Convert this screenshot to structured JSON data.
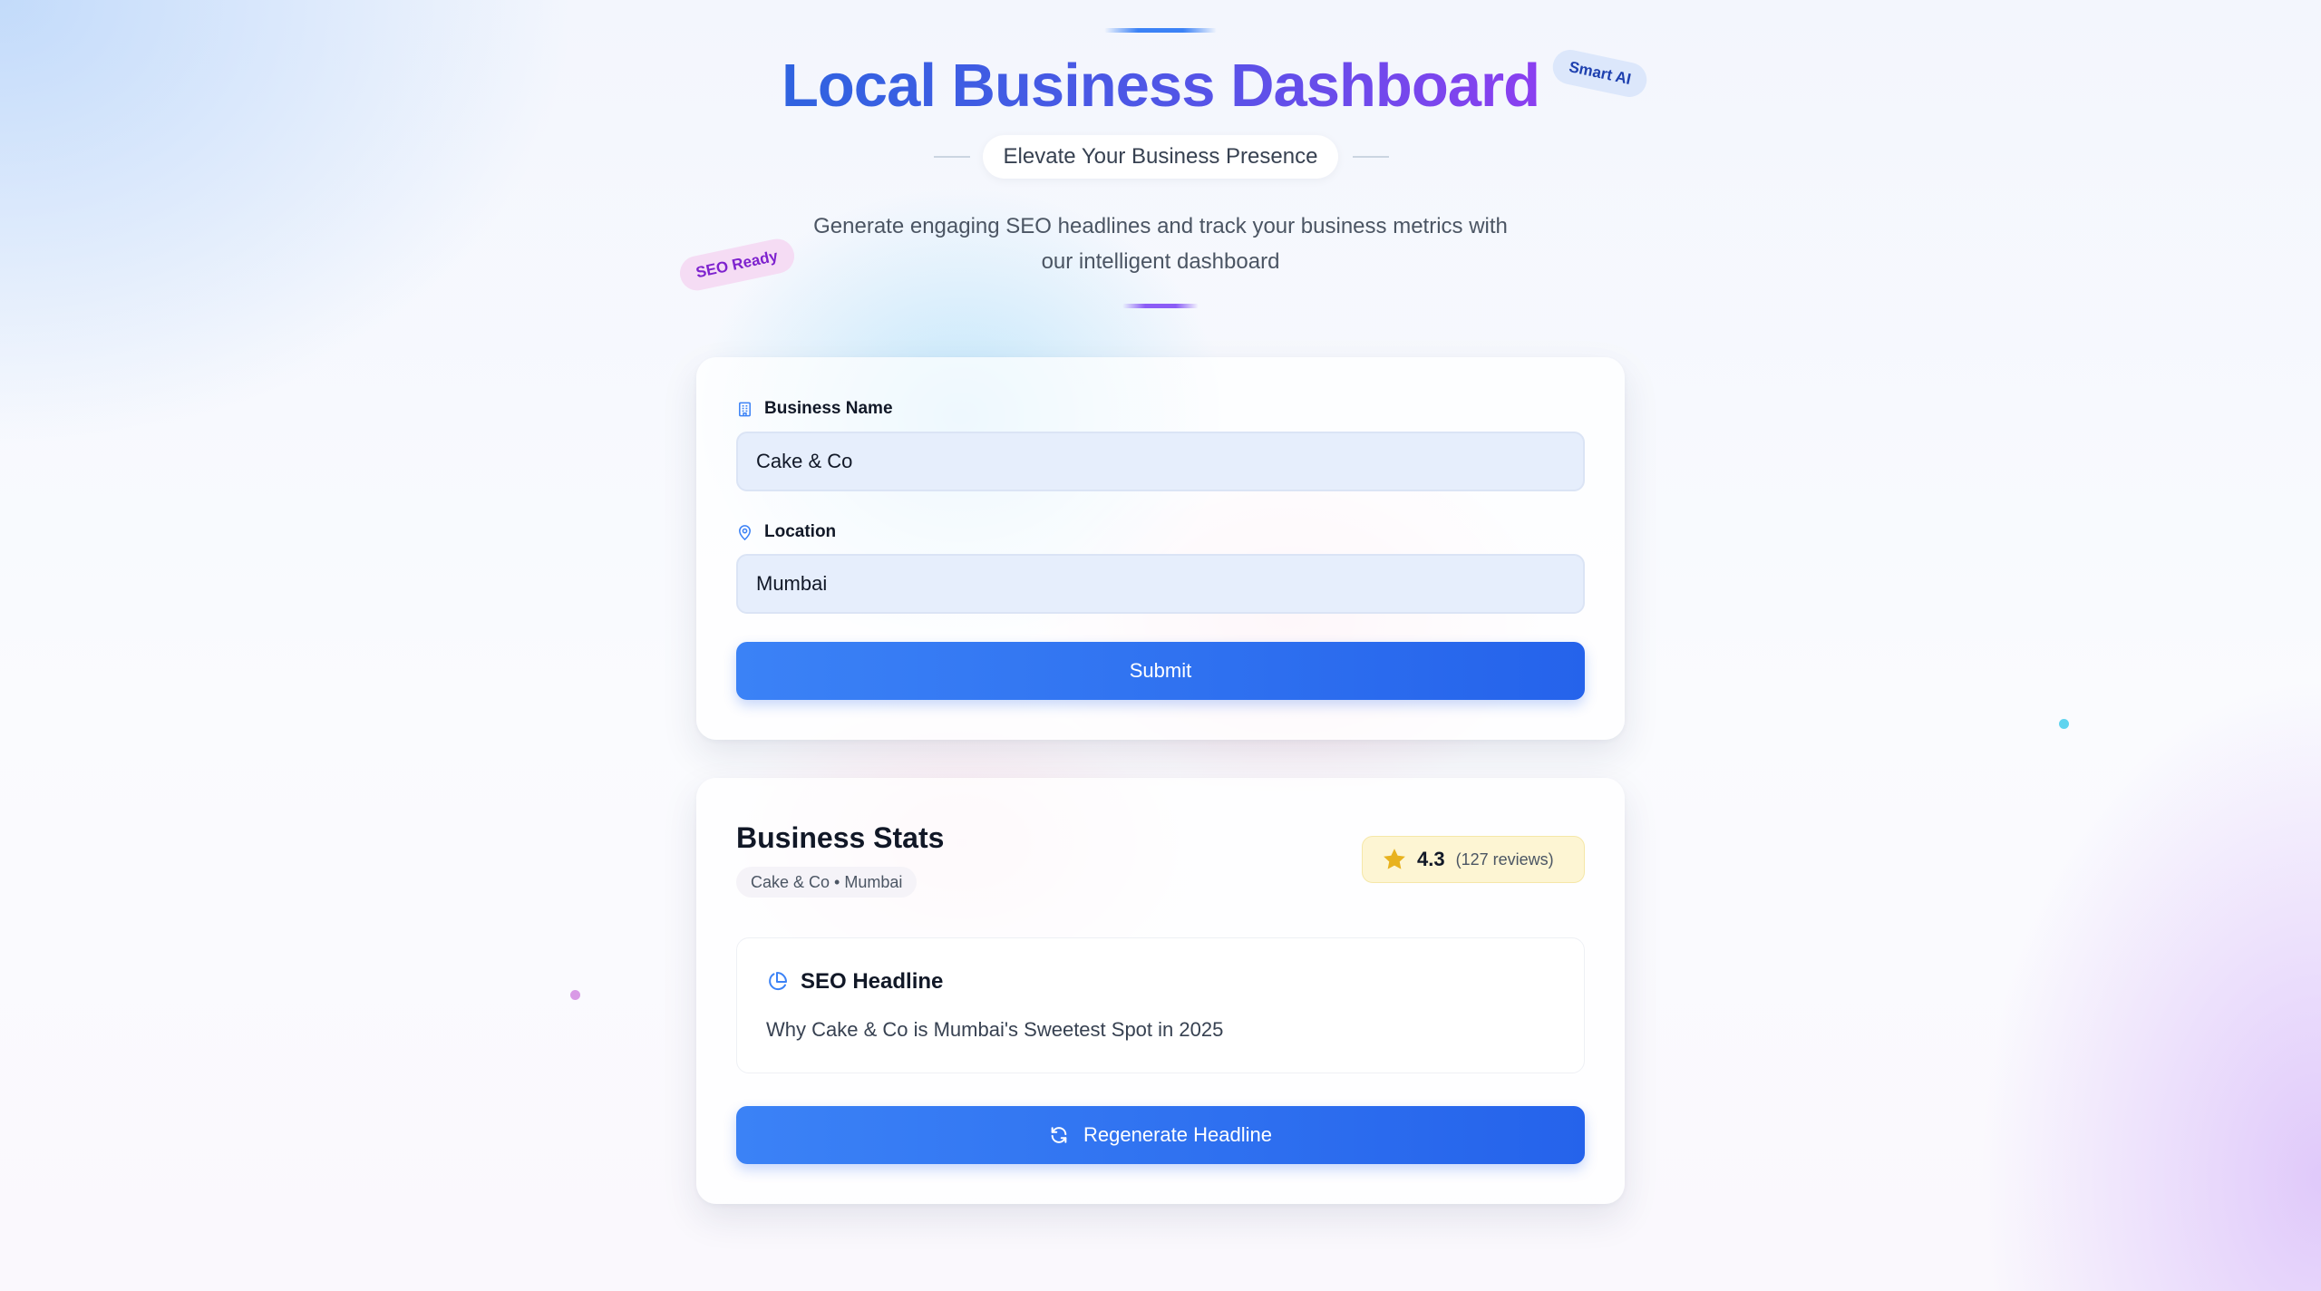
{
  "header": {
    "title": "Local Business Dashboard",
    "subtitle": "Elevate Your Business Presence",
    "description_line1": "Generate engaging SEO headlines and track your business metrics with",
    "description_line2": "our intelligent dashboard",
    "tag_smart": "Smart AI",
    "tag_seo": "SEO Ready"
  },
  "form": {
    "business_name_label": "Business Name",
    "business_name_value": "Cake & Co",
    "location_label": "Location",
    "location_value": "Mumbai",
    "submit_label": "Submit"
  },
  "stats": {
    "title": "Business Stats",
    "subtitle": "Cake & Co • Mumbai",
    "rating": "4.3",
    "reviews": "(127 reviews)",
    "seo_title": "SEO Headline",
    "seo_headline": "Why Cake & Co is Mumbai's Sweetest Spot in 2025",
    "regenerate_label": "Regenerate Headline"
  },
  "colors": {
    "accent": "#3b82f6",
    "accent_dark": "#2563eb",
    "title_gradient_end": "#8b3ff0",
    "star": "#e8b21e"
  },
  "icons": [
    "building-icon",
    "map-pin-icon",
    "star-icon",
    "pie-chart-icon",
    "refresh-icon"
  ]
}
